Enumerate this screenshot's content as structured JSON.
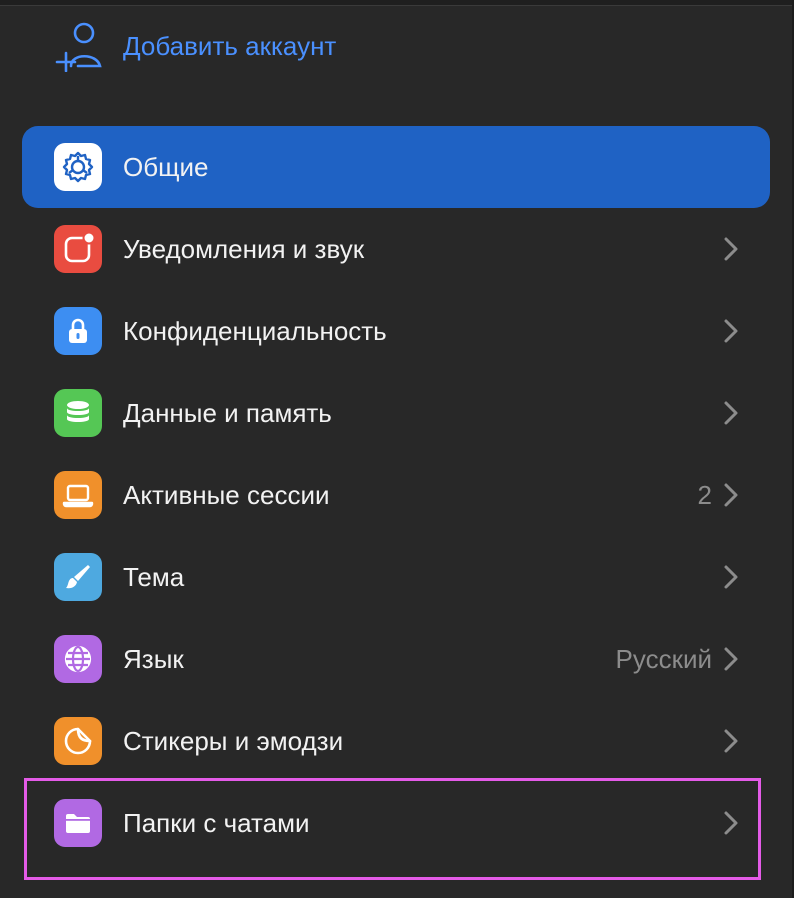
{
  "add_account": {
    "label": "Добавить аккаунт",
    "icon": "add-user-icon"
  },
  "menu": {
    "items": [
      {
        "label": "Общие",
        "icon": "gear-icon",
        "color": "#ffffff",
        "active": true
      },
      {
        "label": "Уведомления и звук",
        "icon": "notification-icon",
        "color": "#e94c40"
      },
      {
        "label": "Конфиденциальность",
        "icon": "lock-icon",
        "color": "#3d8ef2"
      },
      {
        "label": "Данные и память",
        "icon": "database-icon",
        "color": "#55c755"
      },
      {
        "label": "Активные сессии",
        "icon": "laptop-icon",
        "color": "#f0902b",
        "value": "2"
      },
      {
        "label": "Тема",
        "icon": "brush-icon",
        "color": "#4ea9e0"
      },
      {
        "label": "Язык",
        "icon": "globe-icon",
        "color": "#b169e3",
        "value": "Русский"
      },
      {
        "label": "Стикеры и эмодзи",
        "icon": "sticker-icon",
        "color": "#f0902b"
      },
      {
        "label": "Папки с чатами",
        "icon": "folder-icon",
        "color": "#b169e3"
      }
    ]
  },
  "colors": {
    "background": "#282828",
    "accent": "#1f62c4",
    "link": "#4a90ff",
    "highlight": "#e45be7"
  }
}
